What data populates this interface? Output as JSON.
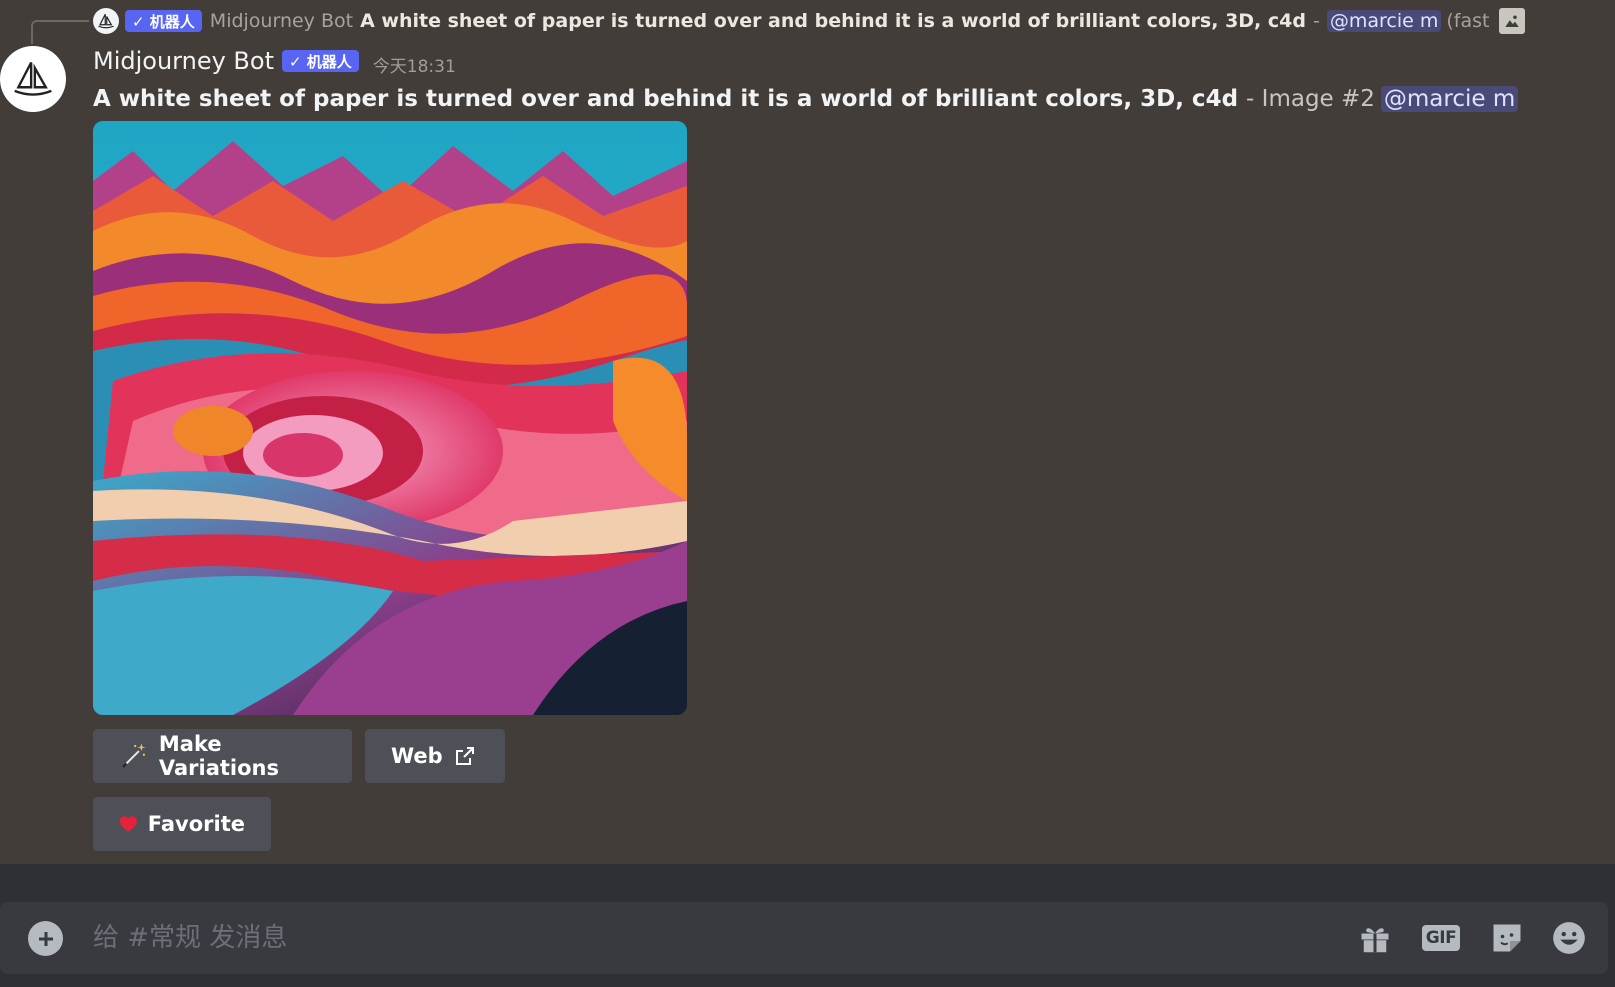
{
  "reply": {
    "bot_tag": "✓ 机器人",
    "author": "Midjourney Bot",
    "prompt": "A white sheet of paper is turned over and behind it is a world of brilliant colors, 3D, c4d",
    "separator": "-",
    "mention": "@marcie m",
    "mode": "(fast"
  },
  "message": {
    "author": "Midjourney Bot",
    "bot_tag": "✓ 机器人",
    "timestamp": "今天18:31",
    "prompt": "A white sheet of paper is turned over and behind it is a world of brilliant colors, 3D, c4d",
    "image_suffix": "- Image #2",
    "mention": "@marcie m"
  },
  "buttons": {
    "variations": "Make Variations",
    "web": "Web",
    "favorite": "Favorite"
  },
  "composer": {
    "placeholder": "给 #常规 发消息",
    "gif_label": "GIF"
  },
  "icons": {
    "reply_avatar": "sailboat-icon",
    "avatar": "sailboat-icon",
    "attachment": "image-icon",
    "variations": "magic-wand-icon",
    "web": "external-link-icon",
    "favorite": "heart-icon",
    "add": "plus-circle-icon",
    "gift": "gift-icon",
    "sticker": "sticker-icon",
    "emoji": "emoji-icon"
  },
  "colors": {
    "chat_bg": "#423d38",
    "bot_tag": "#5865f2",
    "button": "#4e5058",
    "composer": "#383a40"
  }
}
